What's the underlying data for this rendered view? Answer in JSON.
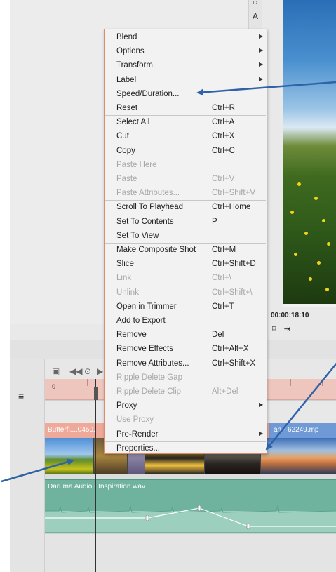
{
  "viewer": {
    "timecode": "00:00:18:10",
    "tool_glyph_top": "○",
    "tool_glyph_text": "A",
    "controls": "⌑ ⇥"
  },
  "timeline": {
    "ruler_start": "0",
    "menu_icon": "≡",
    "video_clip_left_title": "Butterfl....0450.",
    "video_clip_right_title": "an - 62249.mp",
    "audio_clip_title": "Daruma Audio - Inspiration.wav",
    "toolbar_icons": [
      "▣",
      "◀◀",
      "⊙",
      "▶"
    ]
  },
  "context_menu": {
    "items": [
      {
        "label": "Blend",
        "shortcut": "",
        "submenu": true,
        "disabled": false
      },
      {
        "label": "Options",
        "shortcut": "",
        "submenu": true,
        "disabled": false
      },
      {
        "label": "Transform",
        "shortcut": "",
        "submenu": true,
        "disabled": false
      },
      {
        "label": "Label",
        "shortcut": "",
        "submenu": true,
        "disabled": false
      },
      {
        "label": "Speed/Duration...",
        "shortcut": "",
        "submenu": false,
        "disabled": false
      },
      {
        "label": "Reset",
        "shortcut": "Ctrl+R",
        "submenu": false,
        "disabled": false
      },
      {
        "label": "Select All",
        "shortcut": "Ctrl+A",
        "submenu": false,
        "disabled": false
      },
      {
        "label": "Cut",
        "shortcut": "Ctrl+X",
        "submenu": false,
        "disabled": false
      },
      {
        "label": "Copy",
        "shortcut": "Ctrl+C",
        "submenu": false,
        "disabled": false
      },
      {
        "label": "Paste Here",
        "shortcut": "",
        "submenu": false,
        "disabled": true
      },
      {
        "label": "Paste",
        "shortcut": "Ctrl+V",
        "submenu": false,
        "disabled": true
      },
      {
        "label": "Paste Attributes...",
        "shortcut": "Ctrl+Shift+V",
        "submenu": false,
        "disabled": true
      },
      {
        "label": "Scroll To Playhead",
        "shortcut": "Ctrl+Home",
        "submenu": false,
        "disabled": false
      },
      {
        "label": "Set To Contents",
        "shortcut": "P",
        "submenu": false,
        "disabled": false
      },
      {
        "label": "Set To View",
        "shortcut": "",
        "submenu": false,
        "disabled": false
      },
      {
        "label": "Make Composite Shot",
        "shortcut": "Ctrl+M",
        "submenu": false,
        "disabled": false
      },
      {
        "label": "Slice",
        "shortcut": "Ctrl+Shift+D",
        "submenu": false,
        "disabled": false
      },
      {
        "label": "Link",
        "shortcut": "Ctrl+\\",
        "submenu": false,
        "disabled": true
      },
      {
        "label": "Unlink",
        "shortcut": "Ctrl+Shift+\\",
        "submenu": false,
        "disabled": true
      },
      {
        "label": "Open in Trimmer",
        "shortcut": "Ctrl+T",
        "submenu": false,
        "disabled": false
      },
      {
        "label": "Add to Export",
        "shortcut": "",
        "submenu": false,
        "disabled": false
      },
      {
        "label": "Remove",
        "shortcut": "Del",
        "submenu": false,
        "disabled": false
      },
      {
        "label": "Remove Effects",
        "shortcut": "Ctrl+Alt+X",
        "submenu": false,
        "disabled": false
      },
      {
        "label": "Remove Attributes...",
        "shortcut": "Ctrl+Shift+X",
        "submenu": false,
        "disabled": false
      },
      {
        "label": "Ripple Delete Gap",
        "shortcut": "",
        "submenu": false,
        "disabled": true
      },
      {
        "label": "Ripple Delete Clip",
        "shortcut": "Alt+Del",
        "submenu": false,
        "disabled": true
      },
      {
        "label": "Proxy",
        "shortcut": "",
        "submenu": true,
        "disabled": false
      },
      {
        "label": "Use Proxy",
        "shortcut": "",
        "submenu": false,
        "disabled": true
      },
      {
        "label": "Pre-Render",
        "shortcut": "",
        "submenu": true,
        "disabled": false
      },
      {
        "label": "Properties...",
        "shortcut": "",
        "submenu": false,
        "disabled": false
      }
    ],
    "separators_after": [
      5,
      11,
      14,
      20,
      25,
      28
    ]
  },
  "colors": {
    "menu_border": "#e08a6c",
    "annotation_arrow": "#2f63a8",
    "ruler": "#efc6be",
    "audio_clip": "#6fb39e",
    "video_title_left": "#efa99a",
    "video_title_right": "#6f9ad6"
  }
}
